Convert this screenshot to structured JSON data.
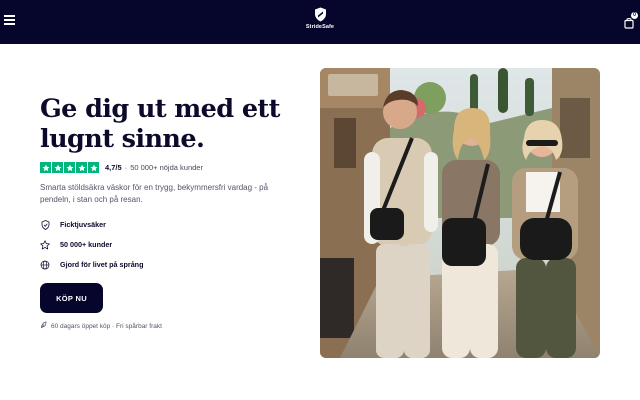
{
  "header": {
    "brand_name": "StrideSafe",
    "cart_count": "0",
    "background_color": "#06052b",
    "menu_icon": "hamburger-menu-icon",
    "logo_icon": "shield-logo-icon",
    "cart_icon": "shopping-bag-icon"
  },
  "hero": {
    "title": "Ge dig ut med ett lugnt sinne.",
    "rating": {
      "stars": 5,
      "star_color": "#00b67a",
      "value": "4,7/5",
      "separator": "·",
      "count_text": "50 000+ nöjda kunder"
    },
    "subtitle": "Smarta stöldsäkra väskor för en trygg, bekymmersfri vardag - på pendeln, i stan och på resan.",
    "features": [
      {
        "icon": "shield-check-icon",
        "label": "Ficktjuvsäker"
      },
      {
        "icon": "star-outline-icon",
        "label": "50 000+ kunder"
      },
      {
        "icon": "globe-icon",
        "label": "Gjord för livet på språng"
      }
    ],
    "cta_label": "KÖP NU",
    "cta_color": "#06052b",
    "shipping_icon": "leaf-icon",
    "shipping_note": "60 dagars öppet köp · Fri spårbar frakt"
  }
}
